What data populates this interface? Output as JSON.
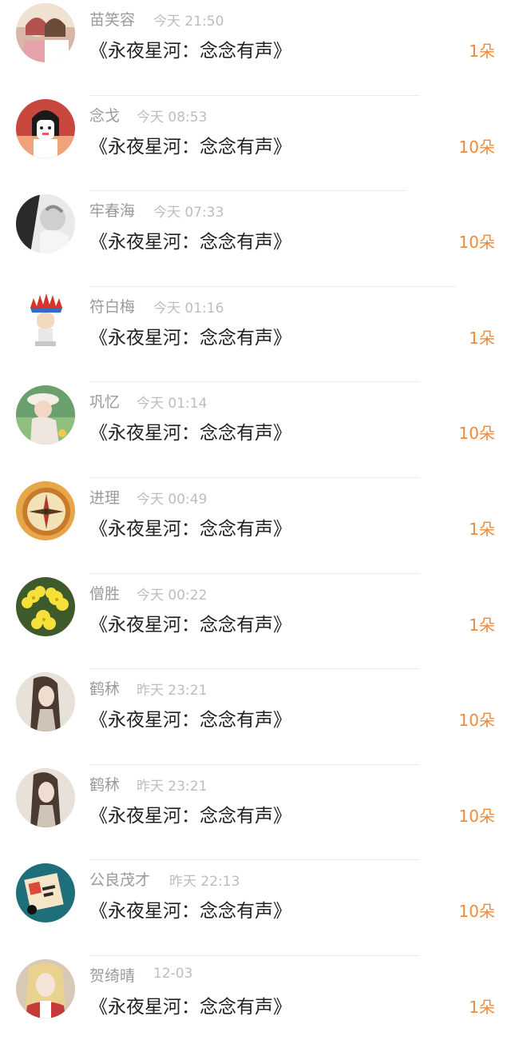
{
  "entries": [
    {
      "name": "苗笑容",
      "time": "今天 21:50",
      "title": "《永夜星河：念念有声》",
      "gift": "1朵",
      "avatar": "avatar-girls-photo"
    },
    {
      "name": "念戈",
      "time": "今天 08:53",
      "title": "《永夜星河：念念有声》",
      "gift": "10朵",
      "avatar": "avatar-cartoon-face"
    },
    {
      "name": "牢春海",
      "time": "今天 07:33",
      "title": "《永夜星河：念念有声》",
      "gift": "10朵",
      "avatar": "avatar-bw-photo"
    },
    {
      "name": "符白梅",
      "time": "今天 01:16",
      "title": "《永夜星河：念念有声》",
      "gift": "1朵",
      "avatar": "avatar-feather-headdress"
    },
    {
      "name": "巩忆",
      "time": "今天 01:14",
      "title": "《永夜星河：念念有声》",
      "gift": "10朵",
      "avatar": "avatar-girl-hat"
    },
    {
      "name": "进理",
      "time": "今天 00:49",
      "title": "《永夜星河：念念有声》",
      "gift": "1朵",
      "avatar": "avatar-compass"
    },
    {
      "name": "僧胜",
      "time": "今天 00:22",
      "title": "《永夜星河：念念有声》",
      "gift": "1朵",
      "avatar": "avatar-yellow-flowers"
    },
    {
      "name": "鹤秫",
      "time": "昨天 23:21",
      "title": "《永夜星河：念念有声》",
      "gift": "10朵",
      "avatar": "avatar-long-hair-girl"
    },
    {
      "name": "鹤秫",
      "time": "昨天 23:21",
      "title": "《永夜星河：念念有声》",
      "gift": "10朵",
      "avatar": "avatar-long-hair-girl"
    },
    {
      "name": "公良茂才",
      "time": "昨天 22:13",
      "title": "《永夜星河：念念有声》",
      "gift": "10朵",
      "avatar": "avatar-cartoon-box"
    },
    {
      "name": "贺绮晴",
      "time": "12-03",
      "title": "《永夜星河：念念有声》",
      "gift": "1朵",
      "avatar": "avatar-blonde-girl"
    }
  ],
  "colors": {
    "name": "#9a9a9a",
    "time": "#bdbdbd",
    "title": "#222222",
    "gift": "#ef8a3a",
    "divider": "#ececec"
  }
}
